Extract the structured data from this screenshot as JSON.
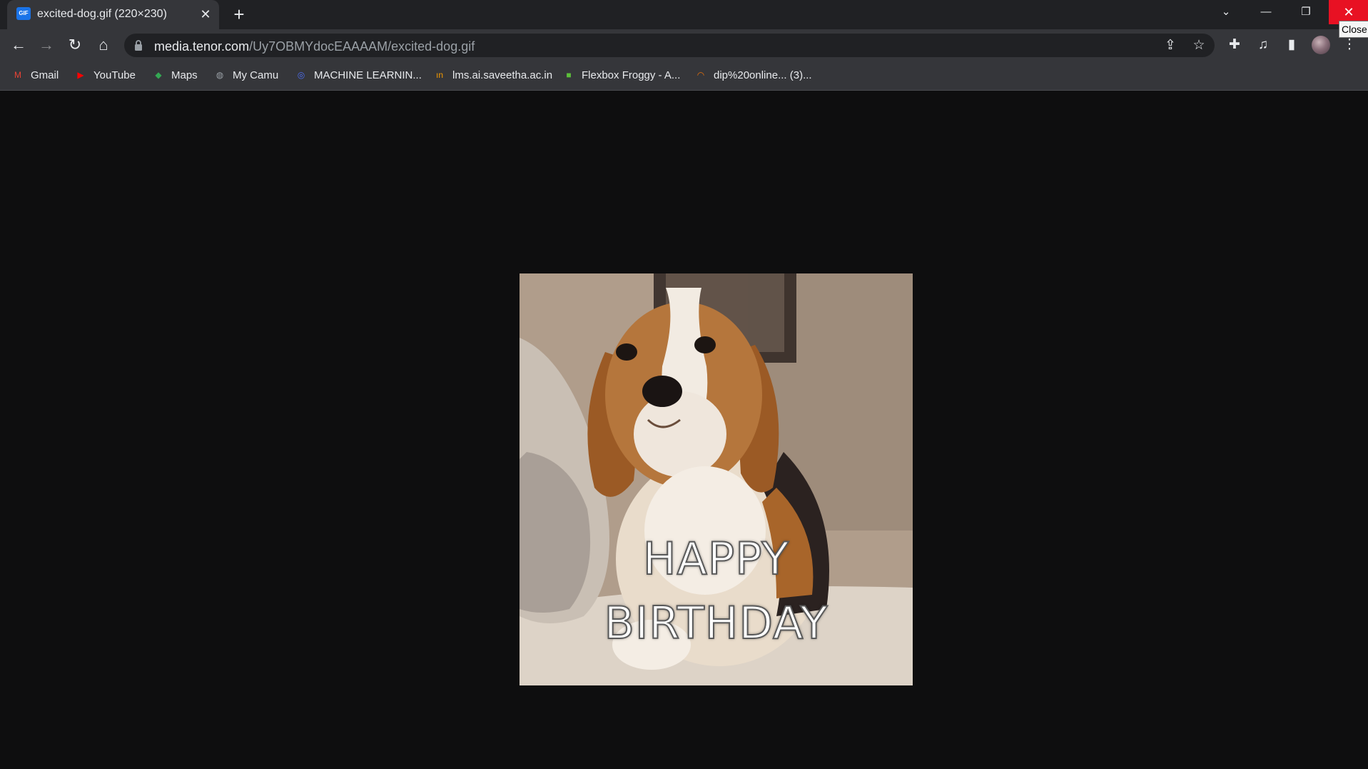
{
  "tab": {
    "favicon_text": "GIF",
    "title": "excited-dog.gif (220×230)",
    "close_glyph": "✕",
    "new_tab_glyph": "+"
  },
  "window_controls": {
    "tab_search_glyph": "⌄",
    "minimize_glyph": "—",
    "restore_glyph": "❐",
    "close_glyph": "✕",
    "close_tooltip": "Close"
  },
  "toolbar": {
    "back_glyph": "←",
    "forward_glyph": "→",
    "reload_glyph": "↻",
    "home_glyph": "⌂",
    "url_host": "media.tenor.com",
    "url_path": "/Uy7OBMYdocEAAAAM/excited-dog.gif",
    "share_glyph": "⇪",
    "star_glyph": "☆",
    "extensions_glyph": "✚",
    "media_glyph": "♫",
    "side_panel_glyph": "▮",
    "menu_glyph": "⋮"
  },
  "bookmarks": [
    {
      "label": "Gmail",
      "icon": "gmail-icon",
      "glyph": "M",
      "color": "#ea4335"
    },
    {
      "label": "YouTube",
      "icon": "youtube-icon",
      "glyph": "▶",
      "color": "#ff0000"
    },
    {
      "label": "Maps",
      "icon": "maps-icon",
      "glyph": "◆",
      "color": "#34a853"
    },
    {
      "label": "My Camu",
      "icon": "globe-icon",
      "glyph": "◍",
      "color": "#9aa0a6"
    },
    {
      "label": "MACHINE LEARNIN...",
      "icon": "target-icon",
      "glyph": "◎",
      "color": "#4c6ef5"
    },
    {
      "label": "lms.ai.saveetha.ac.in",
      "icon": "lms-icon",
      "glyph": "ın",
      "color": "#f29900"
    },
    {
      "label": "Flexbox Froggy - A...",
      "icon": "frog-icon",
      "glyph": "■",
      "color": "#5cbf3a"
    },
    {
      "label": "dip%20online... (3)...",
      "icon": "loading-icon",
      "glyph": "◠",
      "color": "#e8710a"
    }
  ],
  "image": {
    "caption_line1": "HAPPY",
    "caption_line2": "BIRTHDAY"
  }
}
